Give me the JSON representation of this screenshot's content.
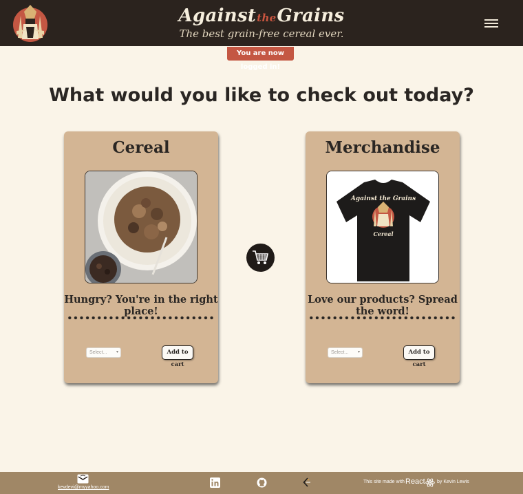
{
  "header": {
    "brand_against": "Against",
    "brand_the": "the",
    "brand_grains": "Grains",
    "tagline": "The best grain-free cereal ever.",
    "menu_icon": "hamburger-icon",
    "logo_icon": "wheat-warrior-logo"
  },
  "toast": {
    "message": "You are now logged in!"
  },
  "main": {
    "heading": "What would you like to check out today?"
  },
  "cards": [
    {
      "title": "Cereal",
      "caption": "Hungry? You're in the right place!",
      "select_placeholder": "Select...",
      "button_label": "Add to cart",
      "image": "cereal-bowl-photo"
    },
    {
      "title": "Merchandise",
      "caption": "Love our products? Spread the word!",
      "select_placeholder": "Select...",
      "button_label": "Add to cart",
      "image": "black-tshirt-photo",
      "shirt_text_top": "Against the Grains",
      "shirt_text_bottom": "Cereal"
    }
  ],
  "cart": {
    "icon": "shopping-cart-icon"
  },
  "footer": {
    "email": "kevdevi@myyahoo.com",
    "credit_prefix": "This site made with",
    "credit_tech": "React",
    "credit_author": "by Kevin Lewis",
    "icons": [
      "email-icon",
      "linkedin-icon",
      "github-icon",
      "leetcode-icon",
      "react-icon"
    ]
  },
  "colors": {
    "header_bg": "#2b231e",
    "page_bg": "#faf4e8",
    "card_bg": "#d3b594",
    "accent": "#c45743",
    "footer_bg": "#a08766"
  }
}
